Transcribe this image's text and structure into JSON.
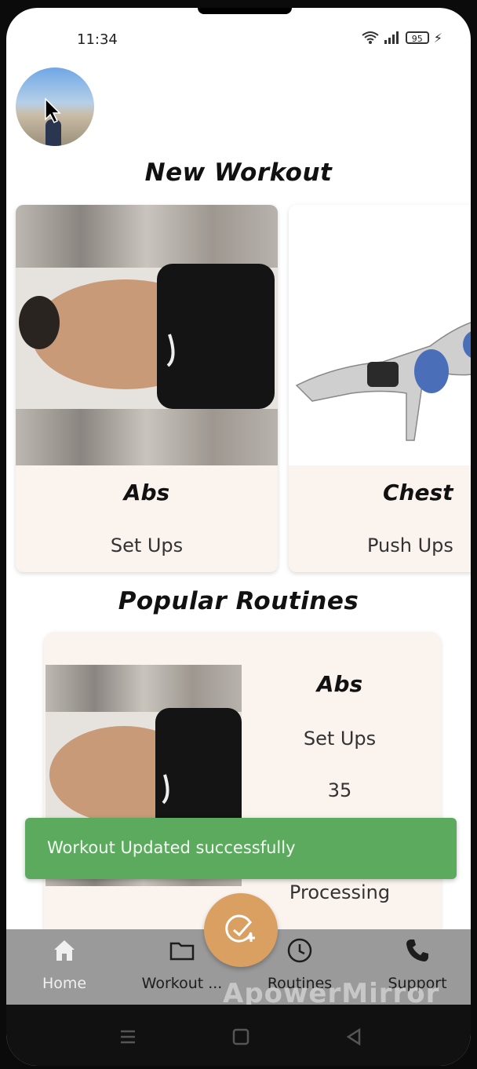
{
  "status_bar": {
    "time": "11:34",
    "battery": "95"
  },
  "sections": {
    "new_workout": "New Workout",
    "popular_routines": "Popular Routines"
  },
  "workouts": [
    {
      "name": "Abs",
      "exercise": "Set Ups"
    },
    {
      "name": "Chest",
      "exercise": "Push Ups"
    }
  ],
  "routine": {
    "name": "Abs",
    "exercise": "Set Ups",
    "count": "35",
    "status": "Processing"
  },
  "toast": {
    "message": "Workout Updated successfully"
  },
  "bottom_nav": [
    {
      "label": "Home",
      "icon": "home-icon"
    },
    {
      "label": "Workout ...",
      "icon": "folder-icon"
    },
    {
      "label": "Routines",
      "icon": "clock-icon"
    },
    {
      "label": "Support",
      "icon": "phone-icon"
    }
  ],
  "fab": {
    "icon": "add-check-icon"
  },
  "watermark": "ApowerMirror",
  "colors": {
    "toast": "#5caa5e",
    "fab": "#d9a062",
    "card_bg": "#faf3ee",
    "nav_bg": "#9a9a9a"
  }
}
